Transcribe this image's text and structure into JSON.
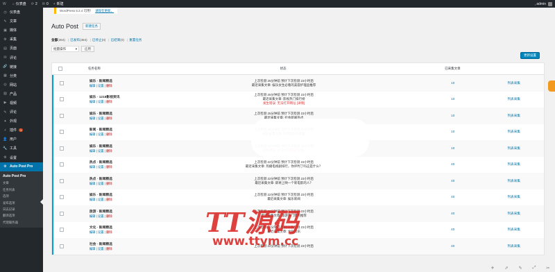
{
  "adminbar": {
    "items": [
      {
        "icon": "wordpress-icon",
        "glyph": "W",
        "label": ""
      },
      {
        "icon": "home-icon",
        "glyph": "⌂",
        "label": "仪表盘"
      },
      {
        "icon": "updates-icon",
        "glyph": "⟳",
        "label": "2"
      },
      {
        "icon": "comments-icon",
        "glyph": "✉",
        "label": "0"
      },
      {
        "icon": "plus-icon",
        "glyph": "+",
        "label": "新建"
      }
    ],
    "user": ", admin"
  },
  "menu": [
    {
      "icon": "dashboard-icon",
      "glyph": "◷",
      "label": "仪表盘"
    },
    {
      "icon": "posts-icon",
      "glyph": "✎",
      "label": "文章"
    },
    {
      "icon": "media-icon",
      "glyph": "▣",
      "label": "媒体"
    },
    {
      "icon": "collect-icon",
      "glyph": "⚙",
      "label": "采集"
    },
    {
      "icon": "pages-icon",
      "glyph": "▤",
      "label": "页面"
    },
    {
      "icon": "comments-icon",
      "glyph": "✉",
      "label": "评论"
    },
    {
      "icon": "links-icon",
      "glyph": "🔗",
      "label": "链接"
    },
    {
      "icon": "category-icon",
      "glyph": "▦",
      "label": "分类"
    },
    {
      "icon": "network-icon",
      "glyph": "◎",
      "label": "网站"
    },
    {
      "icon": "products-icon",
      "glyph": "▧",
      "label": "产品"
    },
    {
      "icon": "video-icon",
      "glyph": "▶",
      "label": "视频"
    },
    {
      "icon": "review-icon",
      "glyph": "✎",
      "label": "评论"
    },
    {
      "icon": "appearance-icon",
      "glyph": "✦",
      "label": "外观"
    },
    {
      "icon": "plugins-icon",
      "glyph": "⚡",
      "label": "插件",
      "badge": "1"
    },
    {
      "icon": "users-icon",
      "glyph": "👤",
      "label": "用户"
    },
    {
      "icon": "tools-icon",
      "glyph": "🔧",
      "label": "工具"
    },
    {
      "icon": "settings-icon",
      "glyph": "⚙",
      "label": "设置"
    }
  ],
  "menu_current": {
    "icon": "autopost-icon",
    "glyph": "⚙",
    "label": "Auto Post Pro"
  },
  "submenu": {
    "title": "Auto Post Pro",
    "items": [
      "文章",
      "任务列表",
      "选项",
      "发布选项",
      "日志记录",
      "翻译选项",
      "代理服务器"
    ]
  },
  "update_nag": {
    "text": "WordPress 5.2.4 可用！",
    "link": "请现在更新。"
  },
  "page": {
    "title": "Auto Post",
    "add_new": "新建任务"
  },
  "views": [
    {
      "label": "全部",
      "count": "(384)",
      "current": true
    },
    {
      "label": "已发布",
      "count": "(384)",
      "current": false
    },
    {
      "label": "已停止",
      "count": "(0)",
      "current": false
    },
    {
      "label": "已结束",
      "count": "(0)",
      "current": false
    },
    {
      "label": "重置任务",
      "count": "",
      "current": false
    }
  ],
  "bulk": {
    "selected": "批量操作",
    "apply": "应用"
  },
  "primary_button": "更新设置",
  "table": {
    "headers": {
      "name": "任务名称",
      "info": "状态",
      "count": "已采集文章",
      "status": ""
    },
    "rows": [
      {
        "name": "娱乐 · 新闻精选",
        "info": [
          "上次检测 25分钟前  预计下次检测 23小时后",
          "最近采集文章: 娱乐女生必看的美容护理品推荐"
        ],
        "count": "10",
        "status": "列表采集",
        "actions": [
          "编辑",
          "设置",
          "删除"
        ]
      },
      {
        "name": "娱乐 · 1218影视资讯",
        "info": [
          "上次检测 25分钟前  预计下次检测 23小时后",
          "最近采集文章: 影视热门排行榜",
          "发生错误: 无法打开网址 [详情]"
        ],
        "count": "10",
        "status": "列表采集",
        "actions": [
          "编辑",
          "设置",
          "删除"
        ]
      },
      {
        "name": "娱乐 · 新闻精选",
        "info": [
          "上次检测 25分钟前  预计下次检测 23小时后",
          "最近采集文章: 社会新闻热点"
        ],
        "count": "10",
        "status": "列表采集",
        "actions": [
          "编辑",
          "设置",
          "删除"
        ]
      },
      {
        "name": "新闻 · 新闻精选",
        "info": [
          "上次检测 25分钟前  预计下次检测 23小时后",
          "最近采集文章: 新闻女生的美容"
        ],
        "count": "10",
        "status": "列表采集",
        "actions": [
          "编辑",
          "设置",
          "删除"
        ]
      },
      {
        "name": "娱乐 · 新闻精选",
        "info": [
          "上次检测 25分钟前  预计下次检测 23小时后",
          "发生错误: 无法打开网址 [详情]"
        ],
        "count": "10",
        "status": "列表采集",
        "actions": [
          "编辑",
          "设置",
          "删除"
        ]
      },
      {
        "name": "热点 · 新闻精选",
        "info": [
          "上次检测 22分钟前  预计下次检测 23小时后",
          "最近采集文章: 热播电视剧排行，你评判了吗这是什么？"
        ],
        "count": "40",
        "status": "列表采集",
        "actions": [
          "编辑",
          "设置",
          "删除"
        ]
      },
      {
        "name": "热点 · 新闻精选",
        "info": [
          "上次检测 22分钟前  预计下次检测 23小时后",
          "最近采集文章: 即将上映一个新电影的人？"
        ],
        "count": "40",
        "status": "列表采集",
        "actions": [
          "编辑",
          "设置",
          "删除"
        ]
      },
      {
        "name": "娱乐 · 新闻精选",
        "info": [
          "上次检测 22分钟前  预计下次检测 23小时后",
          "最近采集文章: 娱乐新闻"
        ],
        "count": "40",
        "status": "列表采集",
        "actions": [
          "编辑",
          "设置",
          "删除"
        ]
      },
      {
        "name": "旅游 · 新闻精选",
        "info": [
          "上次检测 22分钟前  预计下次检测 23小时后",
          "最近采集文章: 旅游热门景点推荐"
        ],
        "count": "40",
        "status": "列表采集",
        "actions": [
          "编辑",
          "设置",
          "删除"
        ]
      },
      {
        "name": "文化 · 新闻精选",
        "info": [
          "上次检测 22分钟前  预计下次检测 23小时后",
          "最近采集文章: 文化资讯"
        ],
        "count": "40",
        "status": "列表采集",
        "actions": [
          "编辑",
          "设置",
          "删除"
        ]
      },
      {
        "name": "社会 · 新闻精选",
        "info": [
          "上次检测 22分钟前  预计下次检测 23小时后"
        ],
        "count": "40",
        "status": "列表采集",
        "actions": [
          "编辑",
          "设置",
          "删除"
        ]
      }
    ]
  },
  "watermark": {
    "logo": "TT源码",
    "url": "www.ttym.cc"
  },
  "colors": {
    "accent": "#0073aa",
    "sidebar": "#23282d",
    "current_menu": "#0073aa",
    "error": "#dc3232",
    "watermark": "#d9211d"
  }
}
